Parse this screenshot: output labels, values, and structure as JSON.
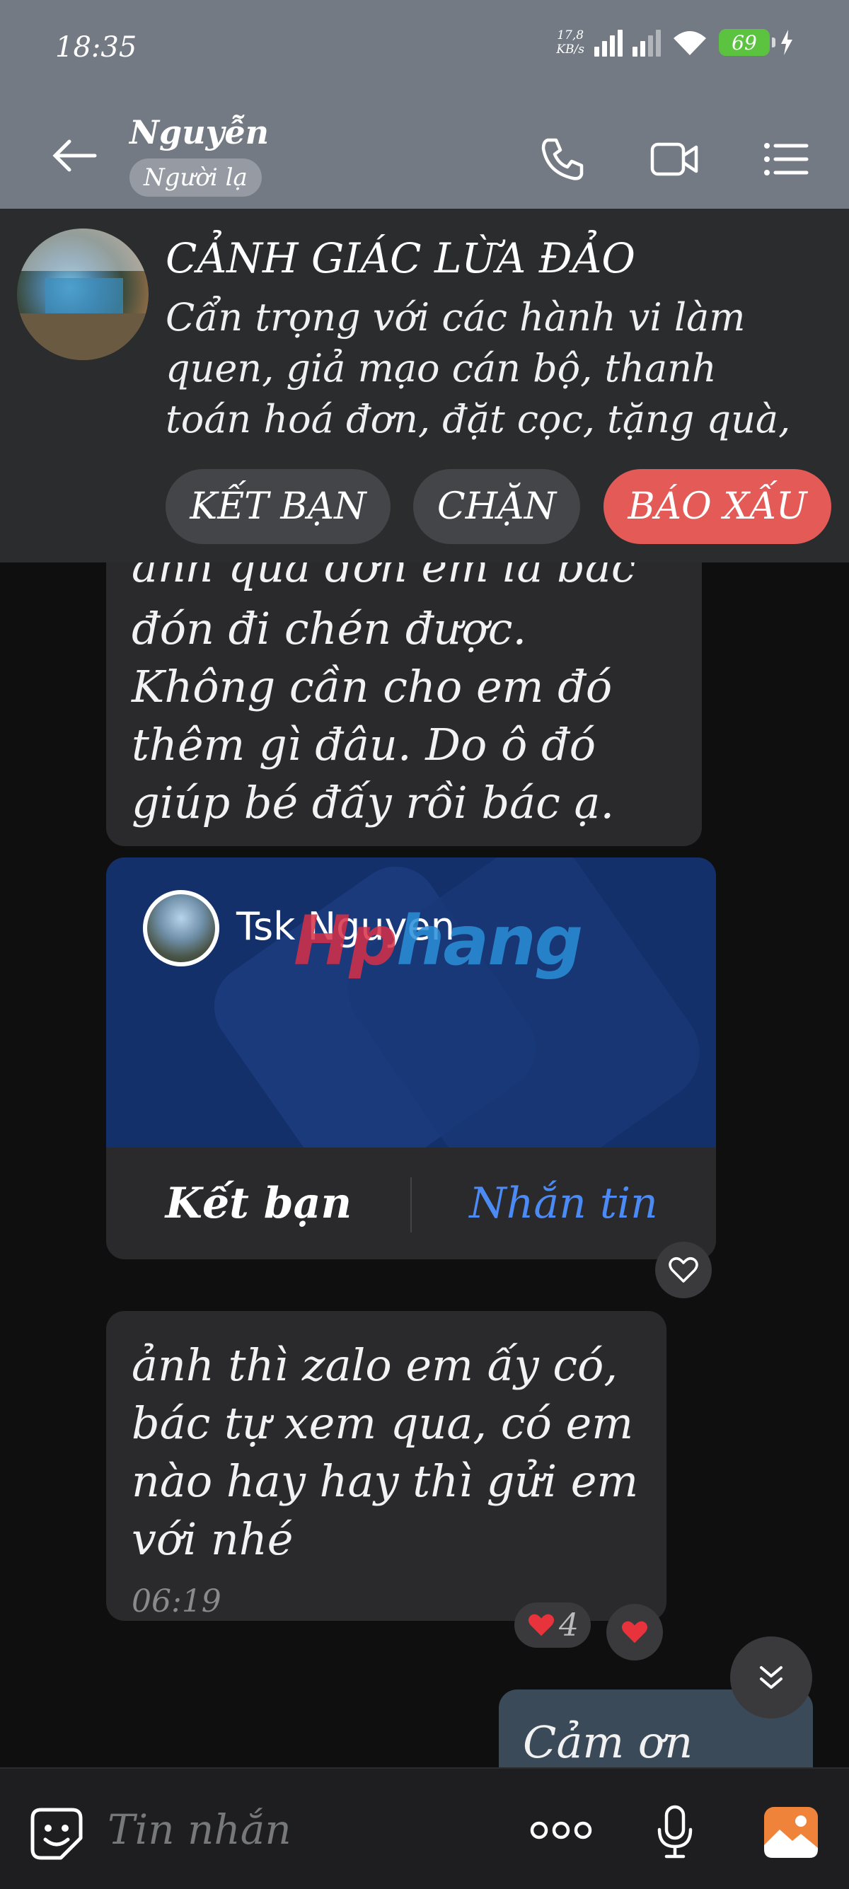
{
  "status_bar": {
    "time": "18:35",
    "net_speed_value": "17,8",
    "net_speed_unit": "KB/s",
    "battery": "69"
  },
  "header": {
    "contact_name": "Nguyễn",
    "badge": "Người lạ"
  },
  "warning": {
    "title": "CẢNH GIÁC LỪA ĐẢO",
    "text": "Cẩn trọng với các hành vi làm quen, giả mạo cán bộ, thanh toán hoá đơn, đặt cọc, tặng quà,",
    "add_friend": "KẾT BẠN",
    "block": "CHẶN",
    "report": "BÁO XẤU"
  },
  "messages": {
    "msg1_hidden_line": "ảnh quá đơn em là bác",
    "msg1_text": "đón đi chén được. Không cần cho em đó thêm gì đâu. Do ô đó giúp bé đấy rồi bác ạ.",
    "card_name": "Tsk Nguyen",
    "card_add_friend": "Kết bạn",
    "card_message": "Nhắn tin",
    "watermark": "Hphang",
    "msg2_text": "ảnh thì zalo em ấy có, bác tự xem qua, có em nào hay hay thì gửi em với nhé",
    "msg2_time": "06:19",
    "reaction_count": "4",
    "msg3_text": "Cảm ơn ông"
  },
  "composer": {
    "placeholder": "Tin nhắn"
  },
  "colors": {
    "header_bg": "#737a84",
    "report_red": "#e35a56",
    "link_blue": "#4c8bf5",
    "battery_green": "#5cc341"
  }
}
